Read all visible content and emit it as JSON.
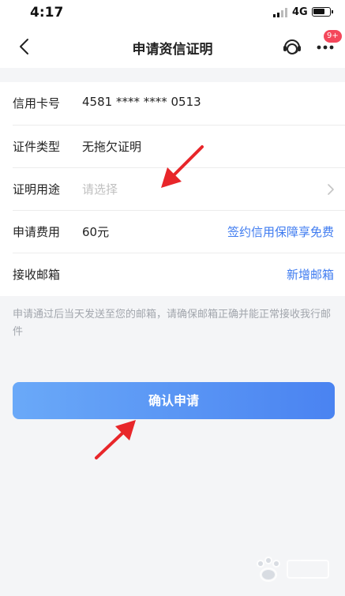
{
  "status_bar": {
    "time": "4:17",
    "network": "4G"
  },
  "nav": {
    "title": "申请资信证明",
    "badge": "9+"
  },
  "form": {
    "rows": [
      {
        "label": "信用卡号",
        "value": "4581 **** **** 0513"
      },
      {
        "label": "证件类型",
        "value": "无拖欠证明"
      },
      {
        "label": "证明用途",
        "placeholder": "请选择"
      },
      {
        "label": "申请费用",
        "value": "60元",
        "link": "签约信用保障享免费"
      },
      {
        "label": "接收邮箱",
        "link": "新增邮箱"
      }
    ]
  },
  "note": "申请通过后当天发送至您的邮箱，请确保邮箱正确并能正常接收我行邮件",
  "confirm_button": {
    "label": "确认申请"
  },
  "colors": {
    "accent": "#3e7bf0",
    "button_start": "#6aa9f8",
    "button_end": "#4a83f1",
    "badge": "#f4475b",
    "annotation_arrow": "#e8262a"
  }
}
